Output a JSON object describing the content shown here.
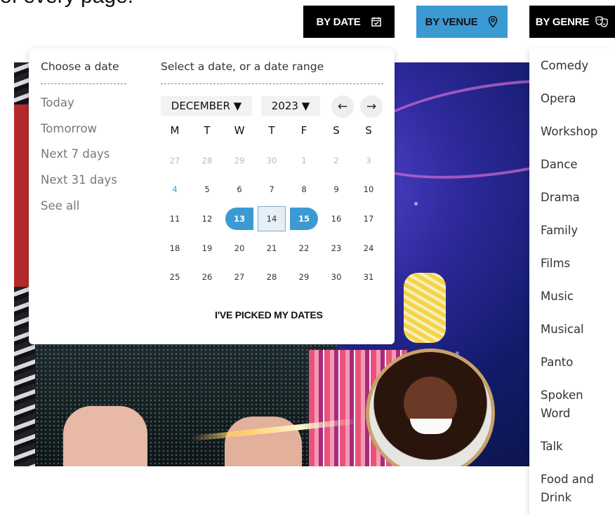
{
  "page": {
    "top_clipped_text": "of every page."
  },
  "filters": {
    "by_date": "BY DATE",
    "by_venue": "BY VENUE",
    "by_genre": "BY GENRE"
  },
  "date_panel": {
    "choose_title": "Choose a date",
    "quick_options": [
      "Today",
      "Tomorrow",
      "Next 7 days",
      "Next 31 days",
      "See all"
    ],
    "range_title": "Select a date, or a date range",
    "month": "DECEMBER ▼",
    "year": "2023 ▼",
    "prev": "←",
    "next": "→",
    "weekdays": [
      "M",
      "T",
      "W",
      "T",
      "F",
      "S",
      "S"
    ],
    "weeks": [
      [
        "27",
        "28",
        "29",
        "30",
        "1",
        "2",
        "3"
      ],
      [
        "4",
        "5",
        "6",
        "7",
        "8",
        "9",
        "10"
      ],
      [
        "11",
        "12",
        "13",
        "14",
        "15",
        "16",
        "17"
      ],
      [
        "18",
        "19",
        "20",
        "21",
        "22",
        "23",
        "24"
      ],
      [
        "25",
        "26",
        "27",
        "28",
        "29",
        "30",
        "31"
      ]
    ],
    "confirm": "I'VE PICKED MY DATES"
  },
  "genres": [
    "Comedy",
    "Opera",
    "Workshop",
    "Dance",
    "Drama",
    "Family",
    "Films",
    "Music",
    "Musical",
    "Panto",
    "Spoken Word",
    "Talk",
    "Food and Drink"
  ],
  "colors": {
    "accent": "#3b9ad4",
    "dark": "#000000",
    "range_fill": "#e4eff7"
  }
}
